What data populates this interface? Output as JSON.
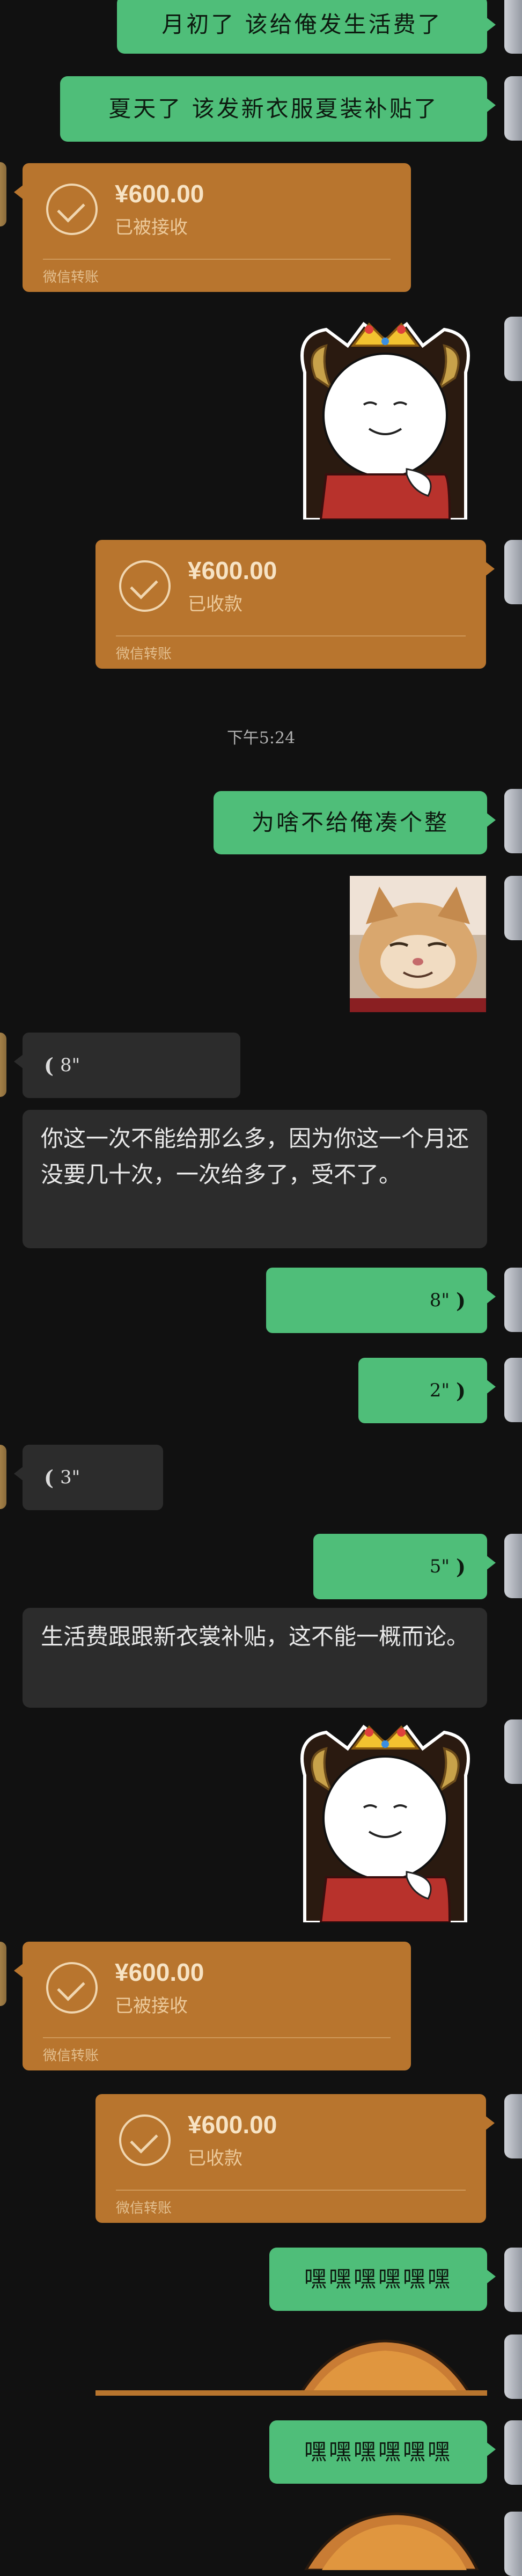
{
  "messages": {
    "m1": "月初了 该给俺发生活费了",
    "m2": "夏天了 该发新衣服夏装补贴了",
    "m3": "为啥不给俺凑个整",
    "m4": "你这一次不能给那么多，因为你这一个月还没要几十次，一次给多了，受不了。",
    "m5": "生活费跟跟新衣裳补贴，这不能一概而论。",
    "m6": "嘿嘿嘿嘿嘿嘿",
    "m7": "嘿嘿嘿嘿嘿嘿"
  },
  "transfers": [
    {
      "amount": "¥600.00",
      "status": "已被接收",
      "footer": "微信转账"
    },
    {
      "amount": "¥600.00",
      "status": "已收款",
      "footer": "微信转账"
    },
    {
      "amount": "¥600.00",
      "status": "已被接收",
      "footer": "微信转账"
    },
    {
      "amount": "¥600.00",
      "status": "已收款",
      "footer": "微信转账"
    }
  ],
  "timestamp": "下午5:24",
  "voices": {
    "v1": "8\"",
    "v2": "8\"",
    "v3": "2\"",
    "v4": "3\"",
    "v5": "5\""
  },
  "icons": [
    "check-circle-icon",
    "voice-wave-icon",
    "avatar"
  ],
  "colors": {
    "background": "#111111",
    "green_bubble": "#4fbe79",
    "dark_bubble": "#2c2c2c",
    "transfer_card": "#b8752e"
  }
}
